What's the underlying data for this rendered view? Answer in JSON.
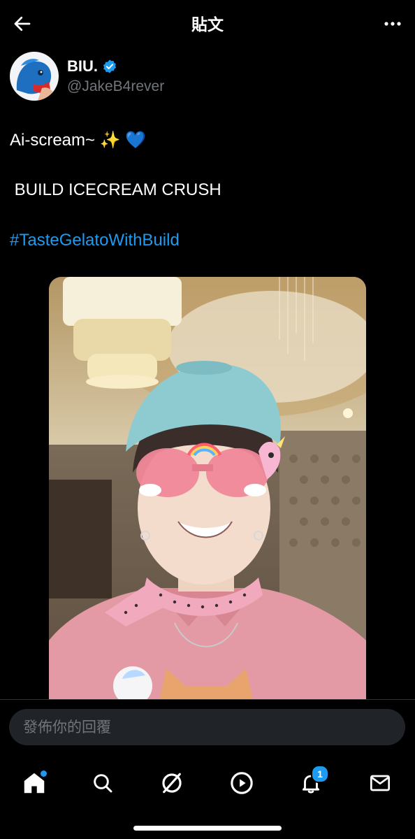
{
  "header": {
    "title": "貼文"
  },
  "author": {
    "name": "BIU.",
    "handle": "@JakeB4rever"
  },
  "post": {
    "line1_text": "Ai-scream~",
    "line1_emoji_sparkles": "✨",
    "line1_emoji_heart": "💙",
    "line2": " BUILD ICECREAM CRUSH",
    "hashtag": "#TasteGelatoWithBuild"
  },
  "reply": {
    "placeholder": "發佈你的回覆"
  },
  "nav": {
    "notifications_badge": "1"
  },
  "colors": {
    "accent": "#1d9bf0",
    "background": "#000000",
    "text": "#e7e9ea",
    "muted": "#71767b"
  }
}
